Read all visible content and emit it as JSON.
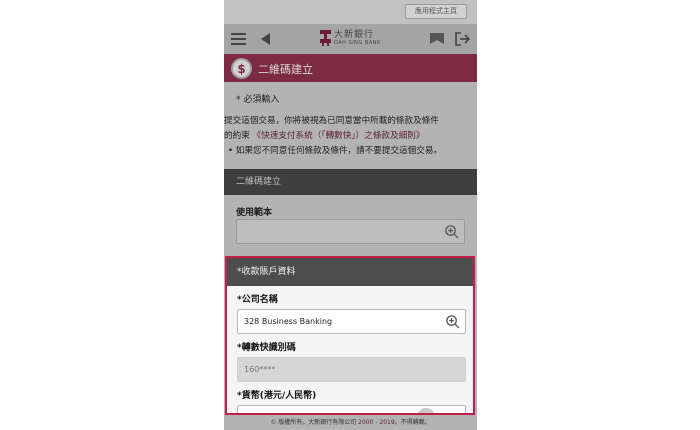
{
  "top_bar": {
    "app_home_label": "應用程式主頁"
  },
  "header": {
    "logo_cn": "大新銀行",
    "logo_en": "DAH SING BANK",
    "icons": [
      "menu-icon",
      "back-icon",
      "flag-icon",
      "logout-icon"
    ]
  },
  "title_bar": {
    "title": "二維碼建立",
    "icon": "qr-money-icon"
  },
  "notice": {
    "required": "* 必須輸入",
    "terms_line1": "提交這個交易，你將被視為已同意當中所載的條款及條件",
    "terms_line2_prefix": "的約束",
    "terms_link": "《快速支付系統（「轉數快」）之條款及細則》",
    "terms_line3": "• 如果您不同意任何條款及條件，請不要提交這個交易。"
  },
  "section": {
    "title": "二維碼建立",
    "template_label": "使用範本",
    "template_value": ""
  },
  "receiving_account": {
    "header": "*收款賬戶資料",
    "company_label": "*公司名稱",
    "company_value": "328 Business Banking",
    "fps_label": "*轉數快識別碼",
    "fps_value": "160****",
    "currency_label": "*貨幣(港元/人民幣)"
  },
  "footer": {
    "prefix": "© 版權所有。大新銀行有限公司 ",
    "years": "2000 - 2019",
    "suffix": "。不得轉載。"
  },
  "colors": {
    "brand": "#7d2b42",
    "highlight_border": "#c41e47",
    "link": "#5e1e2c"
  }
}
